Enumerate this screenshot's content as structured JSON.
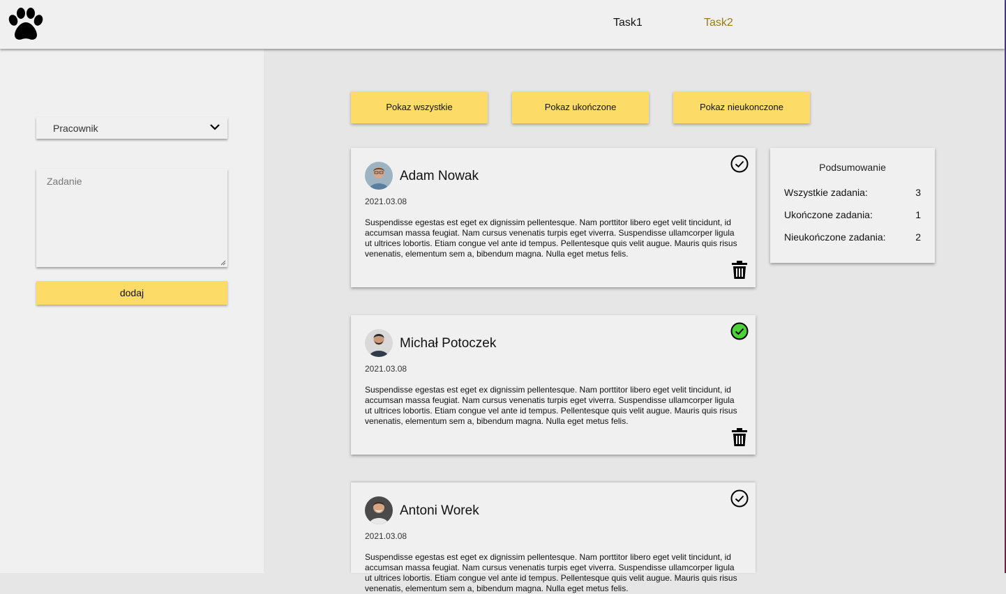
{
  "nav": {
    "logo_icon": "paw-icon",
    "links": [
      {
        "label": "Task1",
        "active": false
      },
      {
        "label": "Task2",
        "active": true
      }
    ],
    "active_color": "#9a7b12"
  },
  "form": {
    "employee_select": {
      "selected": "Pracownik"
    },
    "task_input": {
      "placeholder": "Zadanie"
    },
    "add_label": "dodaj"
  },
  "filters": {
    "show_all": "Pokaz wszystkie",
    "show_done": "Pokaz ukończone",
    "show_undone": "Pokaz nieukonczone"
  },
  "tasks": [
    {
      "name": "Adam Nowak",
      "date": "2021.03.08",
      "text": "Suspendisse egestas est eget ex dignissim pellentesque. Nam porttitor libero eget velit tincidunt, id accumsan massa feugiat. Nam cursus venenatis turpis eget viverra. Suspendisse ullamcorper ligula ut ultrices lobortis. Etiam congue vel ante id tempus. Pellentesque quis velit augue. Mauris quis risus venenatis, elementum sem a, bibendum magna. Nulla eget metus felis.",
      "completed": false
    },
    {
      "name": "Michał Potoczek",
      "date": "2021.03.08",
      "text": "Suspendisse egestas est eget ex dignissim pellentesque. Nam porttitor libero eget velit tincidunt, id accumsan massa feugiat. Nam cursus venenatis turpis eget viverra. Suspendisse ullamcorper ligula ut ultrices lobortis. Etiam congue vel ante id tempus. Pellentesque quis velit augue. Mauris quis risus venenatis, elementum sem a, bibendum magna. Nulla eget metus felis.",
      "completed": true
    },
    {
      "name": "Antoni Worek",
      "date": "2021.03.08",
      "text": "Suspendisse egestas est eget ex dignissim pellentesque. Nam porttitor libero eget velit tincidunt, id accumsan massa feugiat. Nam cursus venenatis turpis eget viverra. Suspendisse ullamcorper ligula ut ultrices lobortis. Etiam congue vel ante id tempus. Pellentesque quis velit augue. Mauris quis risus venenatis, elementum sem a, bibendum magna. Nulla eget metus felis.",
      "completed": false
    }
  ],
  "summary": {
    "title": "Podsumowanie",
    "all_label": "Wszystkie zadania:",
    "all_value": "3",
    "done_label": "Ukończone zadania:",
    "done_value": "1",
    "undone_label": "Nieukończone zadania:",
    "undone_value": "2"
  },
  "colors": {
    "accent": "#fcdc66",
    "completed": "#4cd137",
    "background": "#e6e6e6",
    "panel": "#f0f0f0"
  }
}
